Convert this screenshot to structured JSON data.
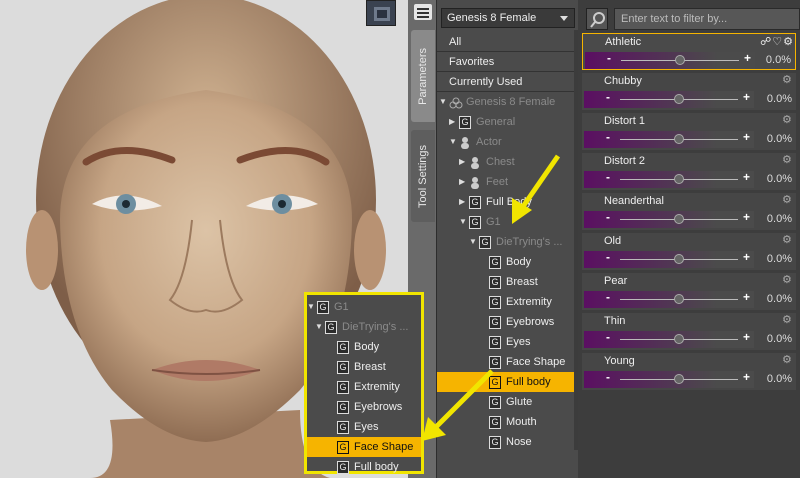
{
  "tabs": {
    "parameters": "Parameters",
    "tool_settings": "Tool Settings"
  },
  "tree": {
    "figure_select": "Genesis 8 Female",
    "all": "All",
    "favorites": "Favorites",
    "currently_used": "Currently Used",
    "root": "Genesis 8 Female",
    "general": "General",
    "actor": "Actor",
    "chest": "Chest",
    "feet": "Feet",
    "full_body_group": "Full Body",
    "g1": "G1",
    "dietrying": "DieTrying's ...",
    "body": "Body",
    "breast": "Breast",
    "extremity": "Extremity",
    "eyebrows": "Eyebrows",
    "eyes": "Eyes",
    "face_shape": "Face Shape",
    "full_body": "Full body",
    "glute": "Glute",
    "mouth": "Mouth",
    "nose": "Nose",
    "icon_group": "G"
  },
  "filter": {
    "placeholder": "Enter text to filter by..."
  },
  "params": [
    {
      "name": "Athletic",
      "value": "0.0%"
    },
    {
      "name": "Chubby",
      "value": "0.0%"
    },
    {
      "name": "Distort 1",
      "value": "0.0%"
    },
    {
      "name": "Distort 2",
      "value": "0.0%"
    },
    {
      "name": "Neanderthal",
      "value": "0.0%"
    },
    {
      "name": "Old",
      "value": "0.0%"
    },
    {
      "name": "Pear",
      "value": "0.0%"
    },
    {
      "name": "Thin",
      "value": "0.0%"
    },
    {
      "name": "Young",
      "value": "0.0%"
    }
  ],
  "slider_sign": {
    "minus": "-",
    "plus": "+"
  },
  "inset": {
    "g1": "G1",
    "dietrying": "DieTrying's ...",
    "body": "Body",
    "breast": "Breast",
    "extremity": "Extremity",
    "eyebrows": "Eyebrows",
    "eyes": "Eyes",
    "face_shape": "Face Shape",
    "full_body": "Full body"
  },
  "colors": {
    "highlight": "#f6b400",
    "annotation": "#f1e500",
    "slider": "#5b0f62"
  }
}
